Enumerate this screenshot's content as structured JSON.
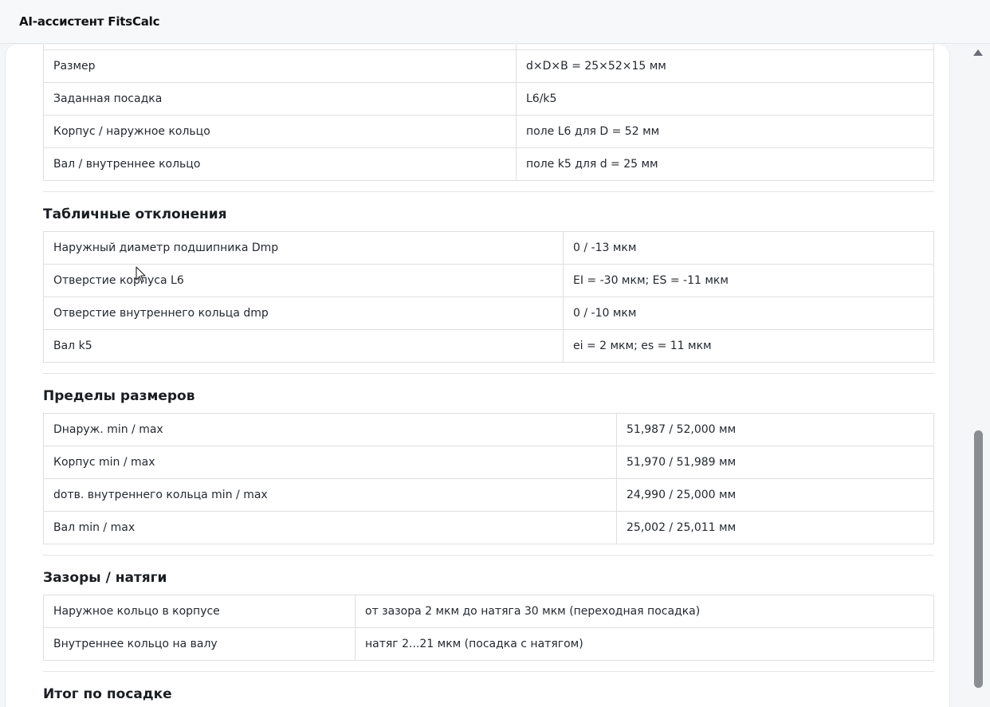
{
  "app": {
    "title": "AI-ассистент FitsCalc"
  },
  "table_params": {
    "rows": [
      {
        "label": "Размер",
        "value": "d×D×B = 25×52×15 мм"
      },
      {
        "label": "Заданная посадка",
        "value": "L6/k5"
      },
      {
        "label": "Корпус / наружное кольцо",
        "value": "поле L6 для D = 52 мм"
      },
      {
        "label": "Вал / внутреннее кольцо",
        "value": "поле k5 для d = 25 мм"
      }
    ]
  },
  "section_deviations": {
    "title": "Табличные отклонения",
    "rows": [
      {
        "label": "Наружный диаметр подшипника Dmp",
        "value": "0 / -13 мкм"
      },
      {
        "label": "Отверстие корпуса L6",
        "value": "EI = -30 мкм; ES = -11 мкм"
      },
      {
        "label": "Отверстие внутреннего кольца dmp",
        "value": "0 / -10 мкм"
      },
      {
        "label": "Вал k5",
        "value": "ei = 2 мкм; es = 11 мкм"
      }
    ]
  },
  "section_limits": {
    "title": "Пределы размеров",
    "rows": [
      {
        "label": "Dнаруж. min / max",
        "value": "51,987 / 52,000 мм"
      },
      {
        "label": "Корпус min / max",
        "value": "51,970 / 51,989 мм"
      },
      {
        "label": "dотв. внутреннего кольца min / max",
        "value": "24,990 / 25,000 мм"
      },
      {
        "label": "Вал min / max",
        "value": "25,002 / 25,011 мм"
      }
    ]
  },
  "section_clearances": {
    "title": "Зазоры / натяги",
    "rows": [
      {
        "label": "Наружное кольцо в корпусе",
        "value": "от зазора 2 мкм до натяга 30 мкм (переходная посадка)"
      },
      {
        "label": "Внутреннее кольцо на валу",
        "value": "натяг 2...21 мкм (посадка с натягом)"
      }
    ]
  },
  "section_summary": {
    "title": "Итог по посадке"
  },
  "colors": {
    "border": "#dcdfe3",
    "scrollbar_thumb": "#8a8d91",
    "background": "#f5f6f8"
  },
  "icons": {
    "scroll_up": "scroll-up-arrow-icon",
    "cursor": "mouse-pointer-icon"
  }
}
